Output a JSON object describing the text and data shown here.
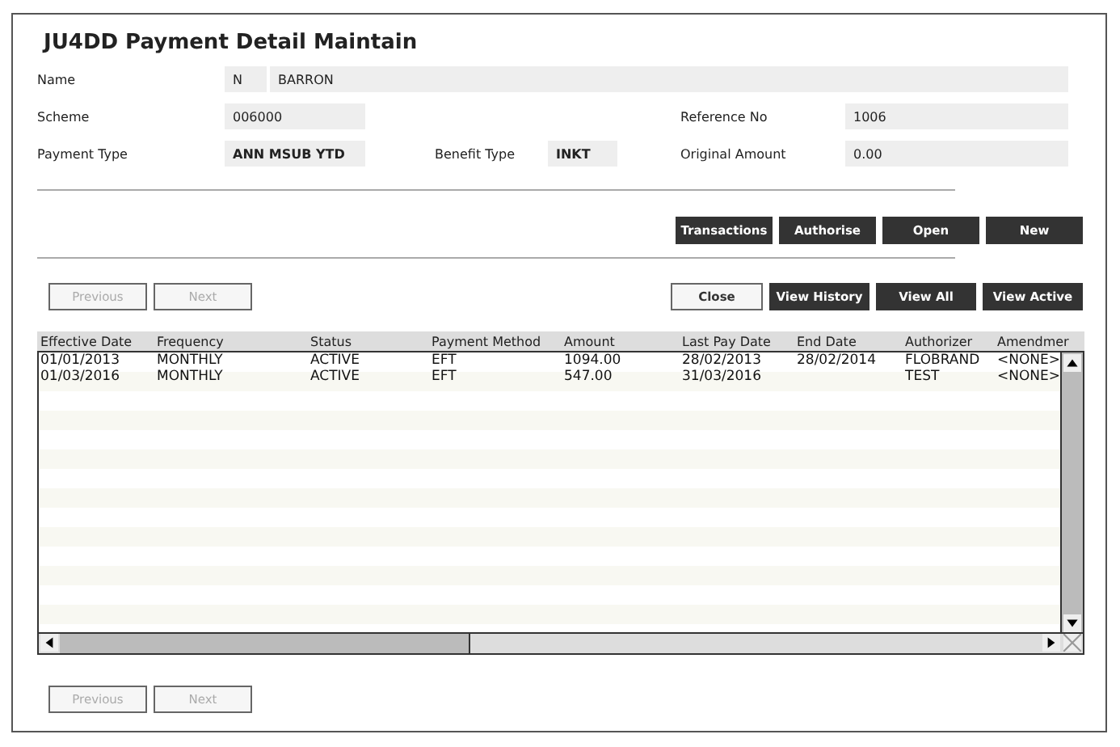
{
  "title": "JU4DD Payment Detail Maintain",
  "fields": {
    "name_label": "Name",
    "name_initial": "N",
    "name_surname": "BARRON",
    "scheme_label": "Scheme",
    "scheme": "006000",
    "reference_label": "Reference No",
    "reference": "1006",
    "payment_type_label": "Payment Type",
    "payment_type": "ANN MSUB YTD",
    "benefit_type_label": "Benefit Type",
    "benefit_type": "INKT",
    "original_amount_label": "Original Amount",
    "original_amount": "0.00"
  },
  "action_buttons": [
    {
      "label": "Transactions"
    },
    {
      "label": "Authorise"
    },
    {
      "label": "Open"
    },
    {
      "label": "New"
    }
  ],
  "top_nav": [
    {
      "label": "Previous",
      "disabled": true
    },
    {
      "label": "Next",
      "disabled": true
    }
  ],
  "view_buttons": [
    {
      "label": "Close",
      "kind": "light"
    },
    {
      "label": "View History",
      "kind": "dark"
    },
    {
      "label": "View All",
      "kind": "dark"
    },
    {
      "label": "View Active",
      "kind": "dark"
    }
  ],
  "table": {
    "columns": [
      "Effective Date",
      "Frequency",
      "Status",
      "Payment Method",
      "Amount",
      "Last Pay Date",
      "End Date",
      "Authorizer",
      "Amendmer"
    ],
    "rows": [
      [
        "01/01/2013",
        "MONTHLY",
        "ACTIVE",
        "EFT",
        "1094.00",
        "28/02/2013",
        "28/02/2014",
        "FLOBRAND",
        "<NONE>"
      ],
      [
        "01/03/2016",
        "MONTHLY",
        "ACTIVE",
        "EFT",
        "547.00",
        "31/03/2016",
        "",
        "TEST",
        "<NONE>"
      ]
    ]
  },
  "bottom_nav": [
    {
      "label": "Previous",
      "disabled": true
    },
    {
      "label": "Next",
      "disabled": true
    }
  ]
}
